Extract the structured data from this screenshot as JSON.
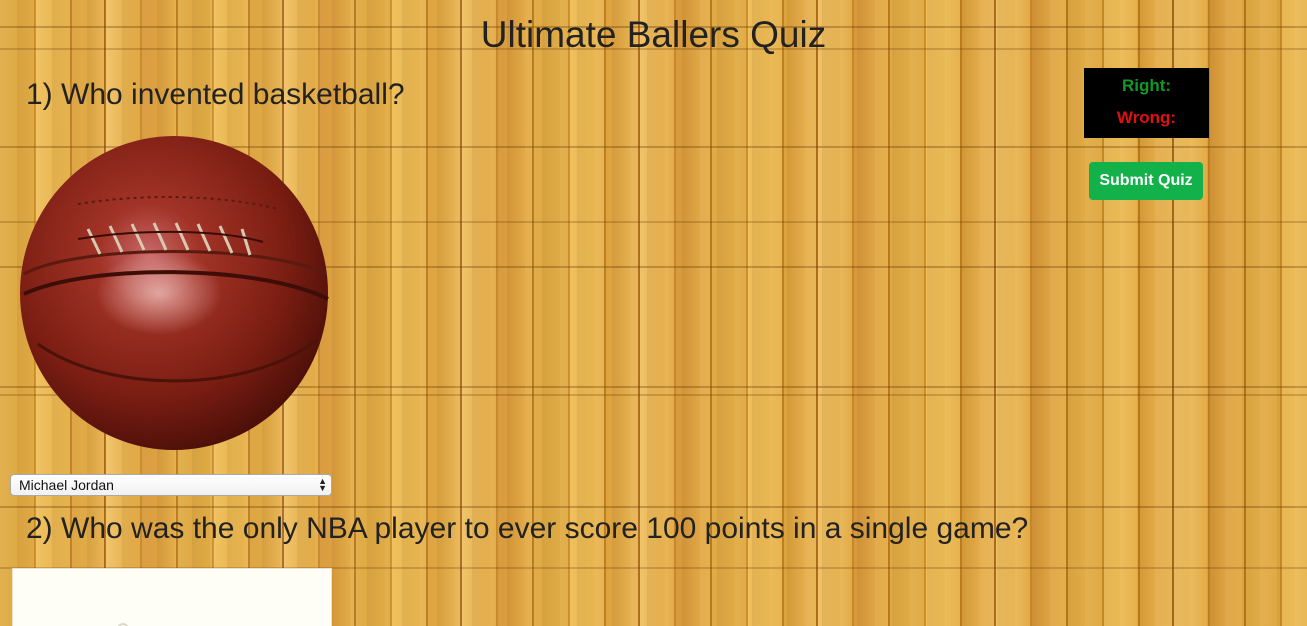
{
  "header": {
    "title": "Ultimate Ballers Quiz"
  },
  "questions": [
    {
      "heading": "1) Who invented basketball?",
      "image_icon": "leather-basketball-icon",
      "selected_answer": "Michael Jordan"
    },
    {
      "heading": "2) Who was the only NBA player to ever score 100 points in a single game?"
    }
  ],
  "scoreboard": {
    "right_label": "Right:",
    "wrong_label": "Wrong:",
    "right_color": "#0f9a27",
    "wrong_color": "#e01010"
  },
  "actions": {
    "submit_label": "Submit Quiz",
    "submit_color": "#12b14a"
  },
  "theme": {
    "background": "hardwood-floor"
  }
}
